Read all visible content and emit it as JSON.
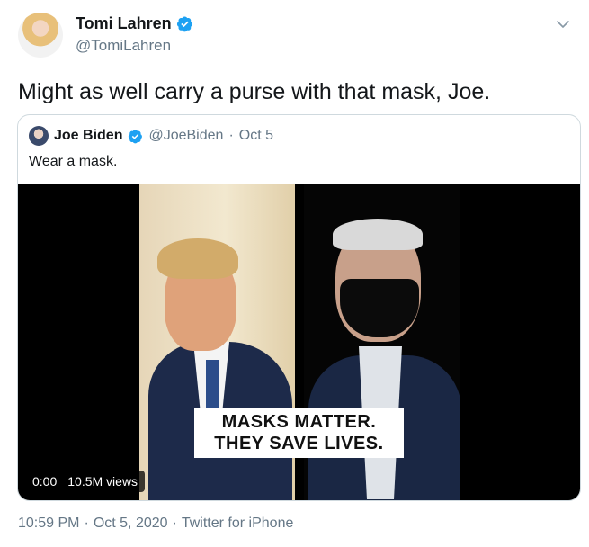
{
  "author": {
    "name": "Tomi Lahren",
    "handle": "@TomiLahren",
    "verified_icon": "verified-badge-icon"
  },
  "tweet": {
    "text": "Might as well carry a purse with that mask, Joe."
  },
  "quoted": {
    "name": "Joe Biden",
    "handle": "@JoeBiden",
    "separator": "·",
    "date": "Oct 5",
    "text": "Wear a mask.",
    "video": {
      "caption_line1": "MASKS MATTER.",
      "caption_line2": "THEY SAVE LIVES.",
      "time": "0:00",
      "views": "10.5M views"
    }
  },
  "meta": {
    "time": "10:59 PM",
    "sep1": "·",
    "date": "Oct 5, 2020",
    "sep2": "·",
    "source": "Twitter for iPhone"
  },
  "colors": {
    "accent": "#1da1f2",
    "muted": "#657786",
    "text": "#14171a"
  }
}
